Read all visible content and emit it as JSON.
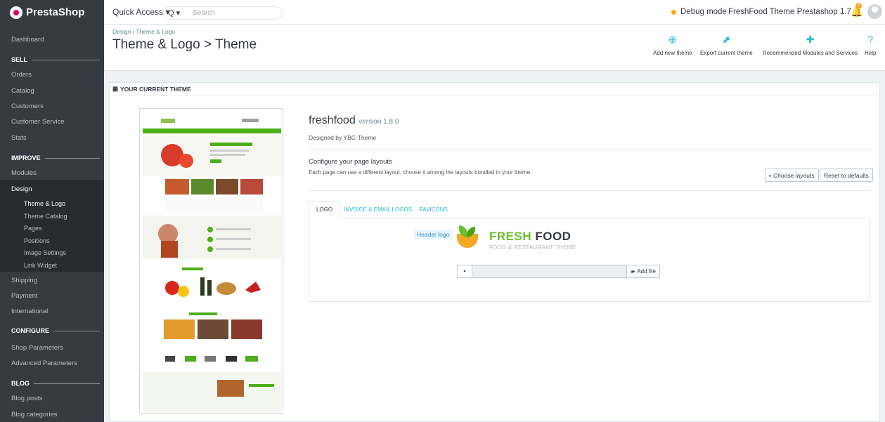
{
  "app": {
    "logo": "PrestaShop"
  },
  "topbar": {
    "quick_access": "Quick Access ▾",
    "search_button": "Q ▾",
    "search_placeholder": "Search",
    "debug_mode": "Debug mode",
    "shop_name": "FreshFood Theme Prestashop 1.7",
    "notif_count": "1"
  },
  "sidebar": {
    "dashboard": "Dashboard",
    "sell": "SELL",
    "orders": "Orders",
    "catalog": "Catalog",
    "customers": "Customers",
    "customer_service": "Customer Service",
    "stats": "Stats",
    "improve": "IMPROVE",
    "modules": "Modules",
    "design": "Design",
    "design_sub": [
      "Theme & Logo",
      "Theme Catalog",
      "Pages",
      "Positions",
      "Image Settings",
      "Link Widget"
    ],
    "shipping": "Shipping",
    "payment": "Payment",
    "international": "International",
    "configure": "CONFIGURE",
    "shop_parameters": "Shop Parameters",
    "advanced_parameters": "Advanced Parameters",
    "blog": "BLOG",
    "blog_posts": "Blog posts",
    "blog_categories": "Blog categories"
  },
  "header": {
    "breadcrumb": "Design  /  Theme & Logo",
    "title": "Theme & Logo > Theme",
    "toolbar": {
      "add_new_theme": "Add new theme",
      "export_theme": "Export current theme",
      "recommended": "Recommended Modules and Services",
      "help": "Help"
    }
  },
  "panel": {
    "heading": "YOUR CURRENT THEME",
    "theme_name": "freshfood",
    "version": "version 1.8.0",
    "designed_by": "Designed by YBC-Theme",
    "config_title": "Configure your page layouts",
    "config_desc": "Each page can use a different layout, choose it among the layouts bundled in your theme.",
    "choose_layouts": "Choose layouts",
    "reset_defaults": "Reset to defaults",
    "tabs": [
      "LOGO",
      "INVOICE & EMAIL LOGOS",
      "FAVICONS"
    ],
    "header_logo_label": "Header logo",
    "logo_text_1": "FRESH",
    "logo_text_2": " FOOD",
    "logo_sub": "FOOD & RESTAURANT THEME",
    "add_file": "Add file"
  },
  "colors": {
    "accent": "#25b9d7",
    "sidebar": "#363a41",
    "brand_green": "#6bbf2a"
  }
}
